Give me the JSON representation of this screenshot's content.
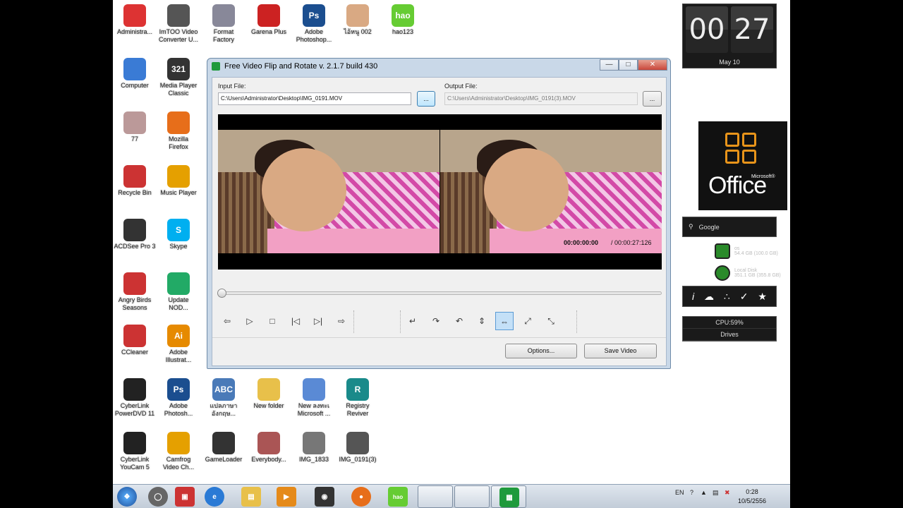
{
  "desktop": {
    "icons": [
      {
        "label": "Administra...",
        "icon": "user-folder-icon",
        "color": "#d33"
      },
      {
        "label": "ImTOO Video\nConverter U...",
        "icon": "film-reel-icon",
        "color": "#555"
      },
      {
        "label": "Format\nFactory",
        "icon": "format-factory-icon",
        "color": "#889"
      },
      {
        "label": "Garena Plus",
        "icon": "garena-icon",
        "color": "#c22"
      },
      {
        "label": "Adobe\nPhotoshop...",
        "icon": "photoshop-icon",
        "color": "#1b4e8f",
        "glyph": "Ps"
      },
      {
        "label": "ไอ้หนู 002",
        "icon": "baby-photo-icon",
        "color": "#d9a983"
      },
      {
        "label": "hao123",
        "icon": "hao123-icon",
        "color": "#6c3",
        "glyph": "hao"
      },
      {
        "label": "Computer",
        "icon": "computer-icon",
        "color": "#3a7bd5"
      },
      {
        "label": "Media Player\nClassic",
        "icon": "media-player-classic-icon",
        "color": "#333",
        "glyph": "321"
      },
      {
        "label": "77",
        "icon": "photo-icon",
        "color": "#b99"
      },
      {
        "label": "Mozilla\nFirefox",
        "icon": "firefox-icon",
        "color": "#e76e1a"
      },
      {
        "label": "Recycle Bin",
        "icon": "recycle-bin-icon",
        "color": "#c33"
      },
      {
        "label": "Music Player",
        "icon": "music-player-icon",
        "color": "#e5a000"
      },
      {
        "label": "ACDSee Pro 3",
        "icon": "camera-icon",
        "color": "#333"
      },
      {
        "label": "Skype",
        "icon": "skype-icon",
        "color": "#00aff0",
        "glyph": "S"
      },
      {
        "label": "Angry Birds\nSeasons",
        "icon": "angry-birds-icon",
        "color": "#c33"
      },
      {
        "label": "Update\nNOD...",
        "icon": "nod32-icon",
        "color": "#2a6"
      },
      {
        "label": "CCleaner",
        "icon": "ccleaner-icon",
        "color": "#c33"
      },
      {
        "label": "Adobe\nIllustrat...",
        "icon": "illustrator-icon",
        "color": "#e68a00",
        "glyph": "Ai"
      },
      {
        "label": "CyberLink\nPowerDVD 11",
        "icon": "powerdvd-icon",
        "color": "#222"
      },
      {
        "label": "Adobe\nPhotosh...",
        "icon": "photoshop-icon",
        "color": "#1b4e8f",
        "glyph": "Ps"
      },
      {
        "label": "แปลภาษา\nอังกฤษ...",
        "icon": "abc-icon",
        "color": "#4a7ab8",
        "glyph": "ABC"
      },
      {
        "label": "New folder",
        "icon": "folder-icon",
        "color": "#e8c04a"
      },
      {
        "label": "New ลงทะเ\nMicrosoft ...",
        "icon": "word-document-icon",
        "color": "#5a8ad5"
      },
      {
        "label": "Registry\nReviver",
        "icon": "registry-reviver-icon",
        "color": "#1a8a8a",
        "glyph": "R"
      },
      {
        "label": "CyberLink\nYouCam 5",
        "icon": "youcam-icon",
        "color": "#222"
      },
      {
        "label": "Camfrog\nVideo Ch...",
        "icon": "camfrog-icon",
        "color": "#e5a000"
      },
      {
        "label": "GameLoader",
        "icon": "gameloader-icon",
        "color": "#333"
      },
      {
        "label": "Everybody...",
        "icon": "game-character-icon",
        "color": "#a55"
      },
      {
        "label": "IMG_1833",
        "icon": "image-file-icon",
        "color": "#777"
      },
      {
        "label": "IMG_0191(3)",
        "icon": "video-file-icon",
        "color": "#555"
      }
    ]
  },
  "gadgets": {
    "clock": {
      "hours": "00",
      "minutes": "27",
      "date": "May 10"
    },
    "office": {
      "text": "Office",
      "microsoft": "Microsoft®"
    },
    "search": {
      "placeholder": "Google"
    },
    "drives": [
      {
        "name": "os",
        "info": "54.4 GB (100.0 GB)"
      },
      {
        "name": "Local Disk",
        "info": "351.1 GB (355.8 GB)"
      }
    ],
    "cpu": {
      "usage": "CPU:59%",
      "drives_label": "Drives"
    }
  },
  "app": {
    "title": "Free Video Flip and Rotate  v. 2.1.7 build 430",
    "input_label": "Input File:",
    "input_value": "C:\\Users\\Administrator\\Desktop\\IMG_0191.MOV",
    "output_label": "Output File:",
    "output_value": "C:\\Users\\Administrator\\Desktop\\IMG_0191(3).MOV",
    "browse_label": "...",
    "current_time": "00:00:00:00",
    "total_time": "/ 00:00:27:126",
    "options_label": "Options...",
    "save_label": "Save Video"
  },
  "taskbar": {
    "lang": "EN",
    "time": "0:28",
    "date": "10/5/2556"
  }
}
